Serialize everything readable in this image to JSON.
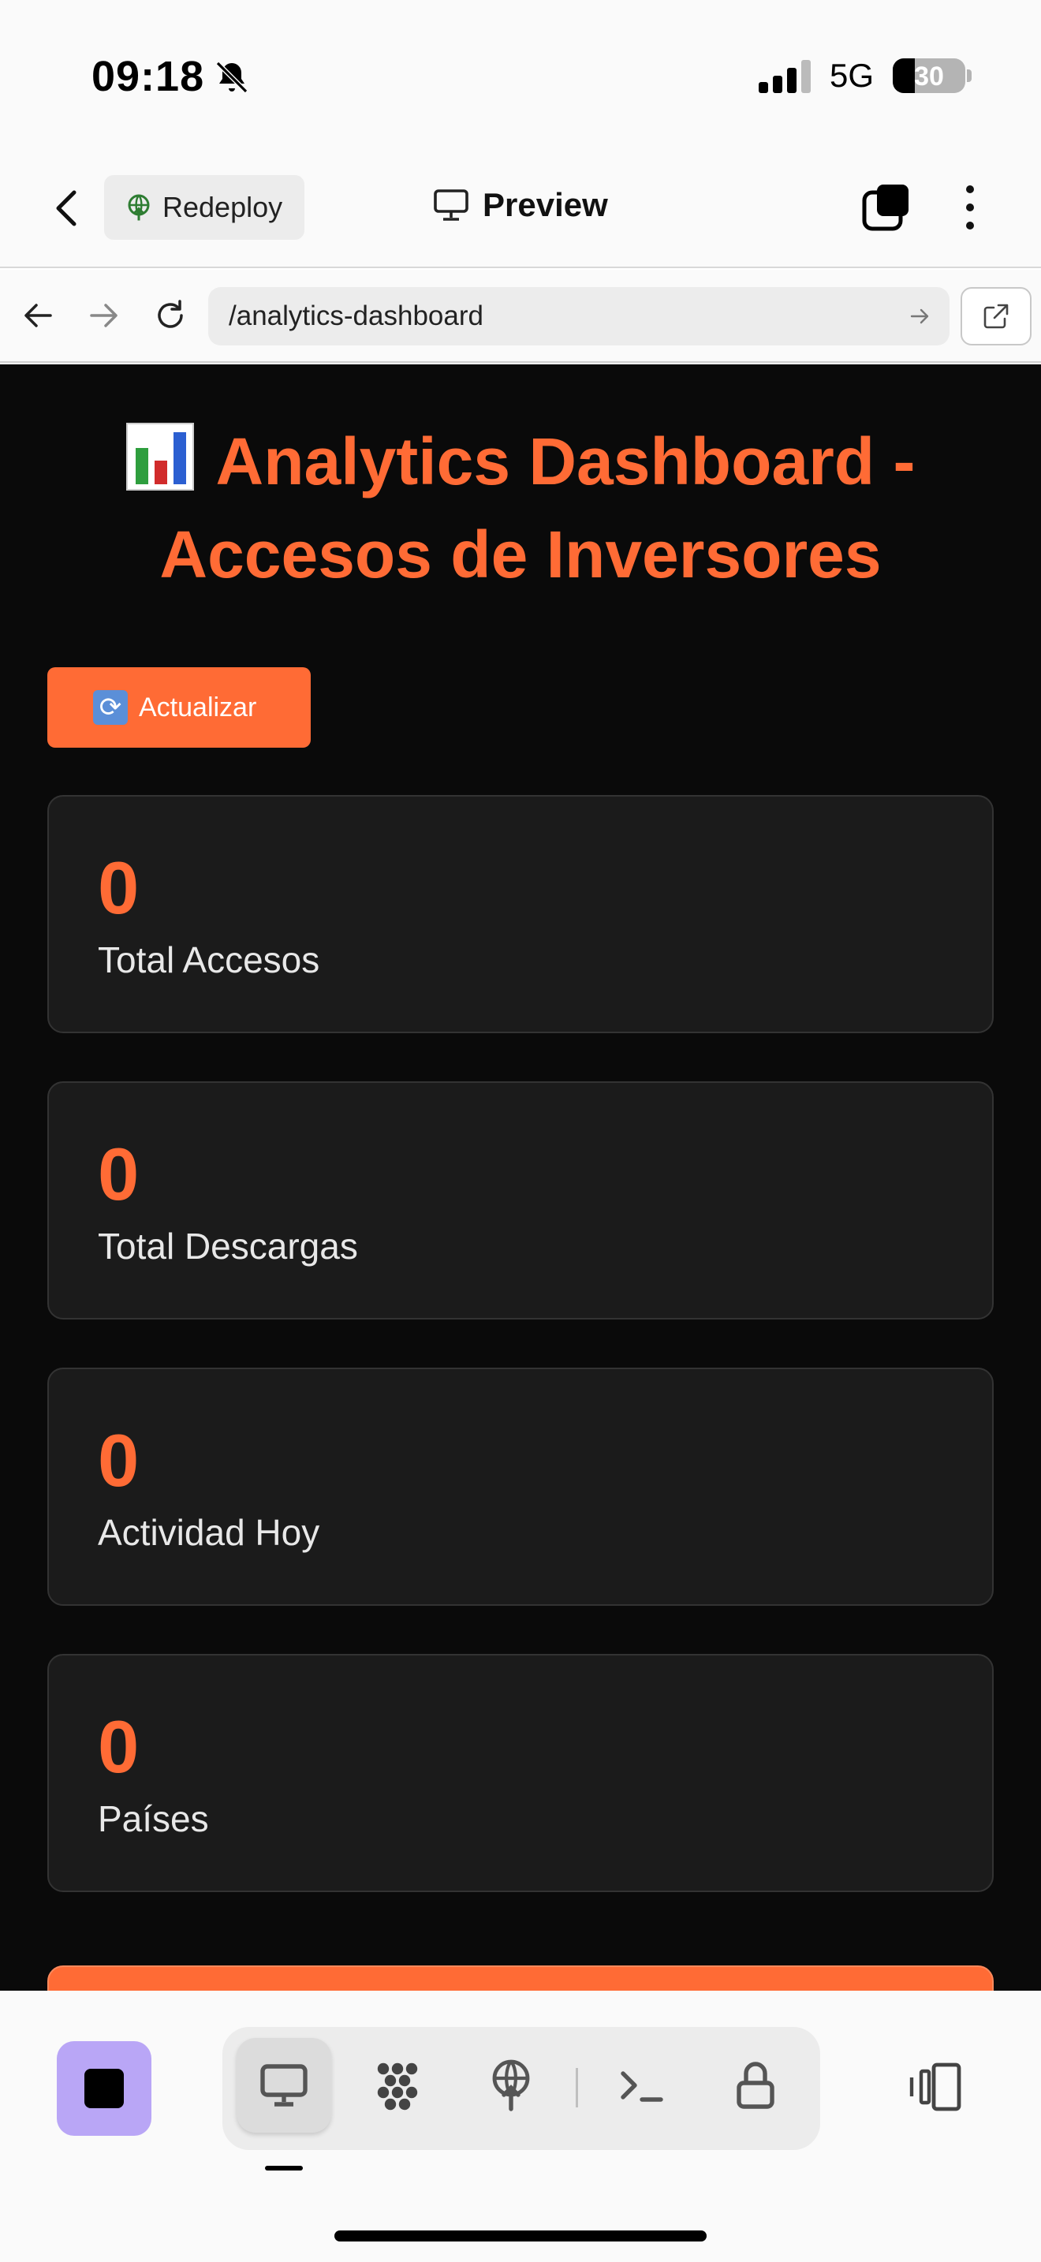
{
  "status_bar": {
    "time": "09:18",
    "network": "5G",
    "battery_percent": 30,
    "battery_label": "30"
  },
  "app_header": {
    "redeploy_label": "Redeploy",
    "preview_label": "Preview"
  },
  "browser": {
    "url": "/analytics-dashboard"
  },
  "page": {
    "title_icon": "bar-chart-emoji",
    "title": "Analytics Dashboard - Accesos de Inversores",
    "refresh_label": "Actualizar",
    "stats": [
      {
        "value": "0",
        "label": "Total Accesos"
      },
      {
        "value": "0",
        "label": "Total Descargas"
      },
      {
        "value": "0",
        "label": "Actividad Hoy"
      },
      {
        "value": "0",
        "label": "Países"
      }
    ]
  },
  "toolbar": {
    "tools": [
      "desktop-icon",
      "apps-grid-icon",
      "deploy-globe-icon",
      "terminal-icon",
      "lock-icon"
    ],
    "active_tool": "desktop-icon"
  },
  "colors": {
    "accent": "#ff6b35",
    "page_bg": "#0a0a0a",
    "card_bg": "#1b1b1b",
    "stop_button": "#b9a6f6"
  }
}
